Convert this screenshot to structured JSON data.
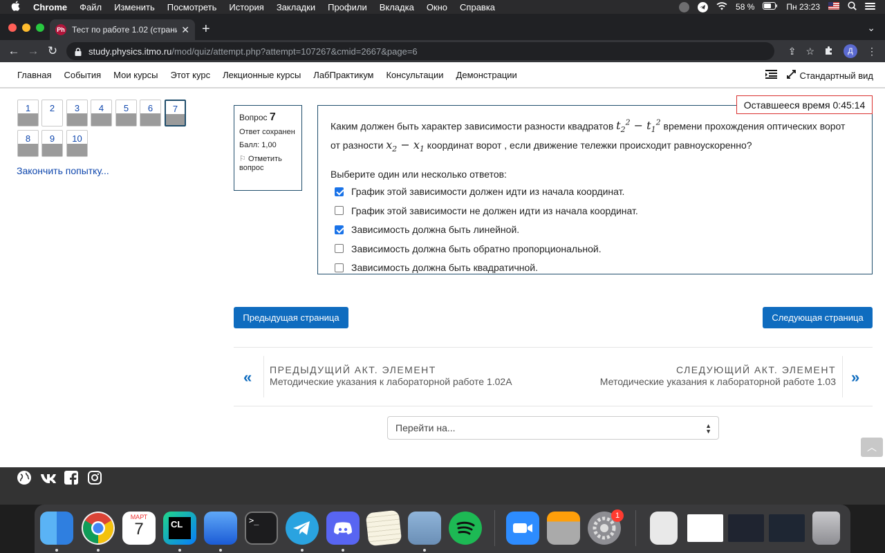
{
  "menubar": {
    "app_name": "Chrome",
    "items": [
      "Файл",
      "Изменить",
      "Посмотреть",
      "История",
      "Закладки",
      "Профили",
      "Вкладка",
      "Окно",
      "Справка"
    ],
    "battery": "58 %",
    "clock": "Пн 23:23"
  },
  "browser": {
    "tab_title": "Тест по работе 1.02 (страниц",
    "tab_favicon": "Ph",
    "url_host": "study.physics.itmo.ru",
    "url_path": "/mod/quiz/attempt.php?attempt=107267&cmid=2667&page=6",
    "profile_initial": "Д"
  },
  "site_nav": {
    "items": [
      "Главная",
      "События",
      "Мои курсы",
      "Этот курс",
      "Лекционные курсы",
      "ЛабПрактикум",
      "Консультации",
      "Демонстрации"
    ],
    "standard_view": "Стандартный вид"
  },
  "quiz_nav": {
    "buttons": [
      {
        "label": "1",
        "answered": true
      },
      {
        "label": "2",
        "answered": false
      },
      {
        "label": "3",
        "answered": true
      },
      {
        "label": "4",
        "answered": true
      },
      {
        "label": "5",
        "answered": true
      },
      {
        "label": "6",
        "answered": true
      },
      {
        "label": "7",
        "answered": true,
        "current": true
      },
      {
        "label": "8",
        "answered": true
      },
      {
        "label": "9",
        "answered": true
      },
      {
        "label": "10",
        "answered": true
      }
    ],
    "finish_link": "Закончить попытку..."
  },
  "question": {
    "label": "Вопрос",
    "number": "7",
    "state": "Ответ сохранен",
    "grade": "Балл: 1,00",
    "flag": "Отметить вопрос",
    "text_before": "Каким должен быть характер зависимости разности квадратов",
    "text_middle": "времени прохождения оптических ворот от разности",
    "text_after": "координат ворот , если движение тележки происходит равноускоренно?",
    "prompt": "Выберите один или несколько ответов:",
    "answers": [
      {
        "text": "График этой зависимости  должен идти из начала координат.",
        "checked": true
      },
      {
        "text": "График этой зависимости  не должен идти из начала координат.",
        "checked": false
      },
      {
        "text": "Зависимость  должна быть линейной.",
        "checked": true
      },
      {
        "text": "Зависимость  должна быть обратно пропорциональной.",
        "checked": false
      },
      {
        "text": "Зависимость  должна быть квадратичной.",
        "checked": false
      }
    ]
  },
  "timer": "Оставшееся время 0:45:14",
  "buttons": {
    "prev_page": "Предыдущая страница",
    "next_page": "Следующая страница"
  },
  "activity_nav": {
    "prev_label": "ПРЕДЫДУЩИЙ АКТ. ЭЛЕМЕНТ",
    "prev_name": "Методические указания к лабораторной работе 1.02А",
    "next_label": "СЛЕДУЮЩИЙ АКТ. ЭЛЕМЕНТ",
    "next_name": "Методические указания к лабораторной работе 1.03"
  },
  "jump_select": "Перейти на...",
  "dock": {
    "calendar_month": "МАРТ",
    "calendar_day": "7",
    "settings_badge": "1"
  },
  "colors": {
    "accent": "#0f6cbf",
    "timer_border": "#d9302e",
    "question_border": "#1f4d6b"
  }
}
